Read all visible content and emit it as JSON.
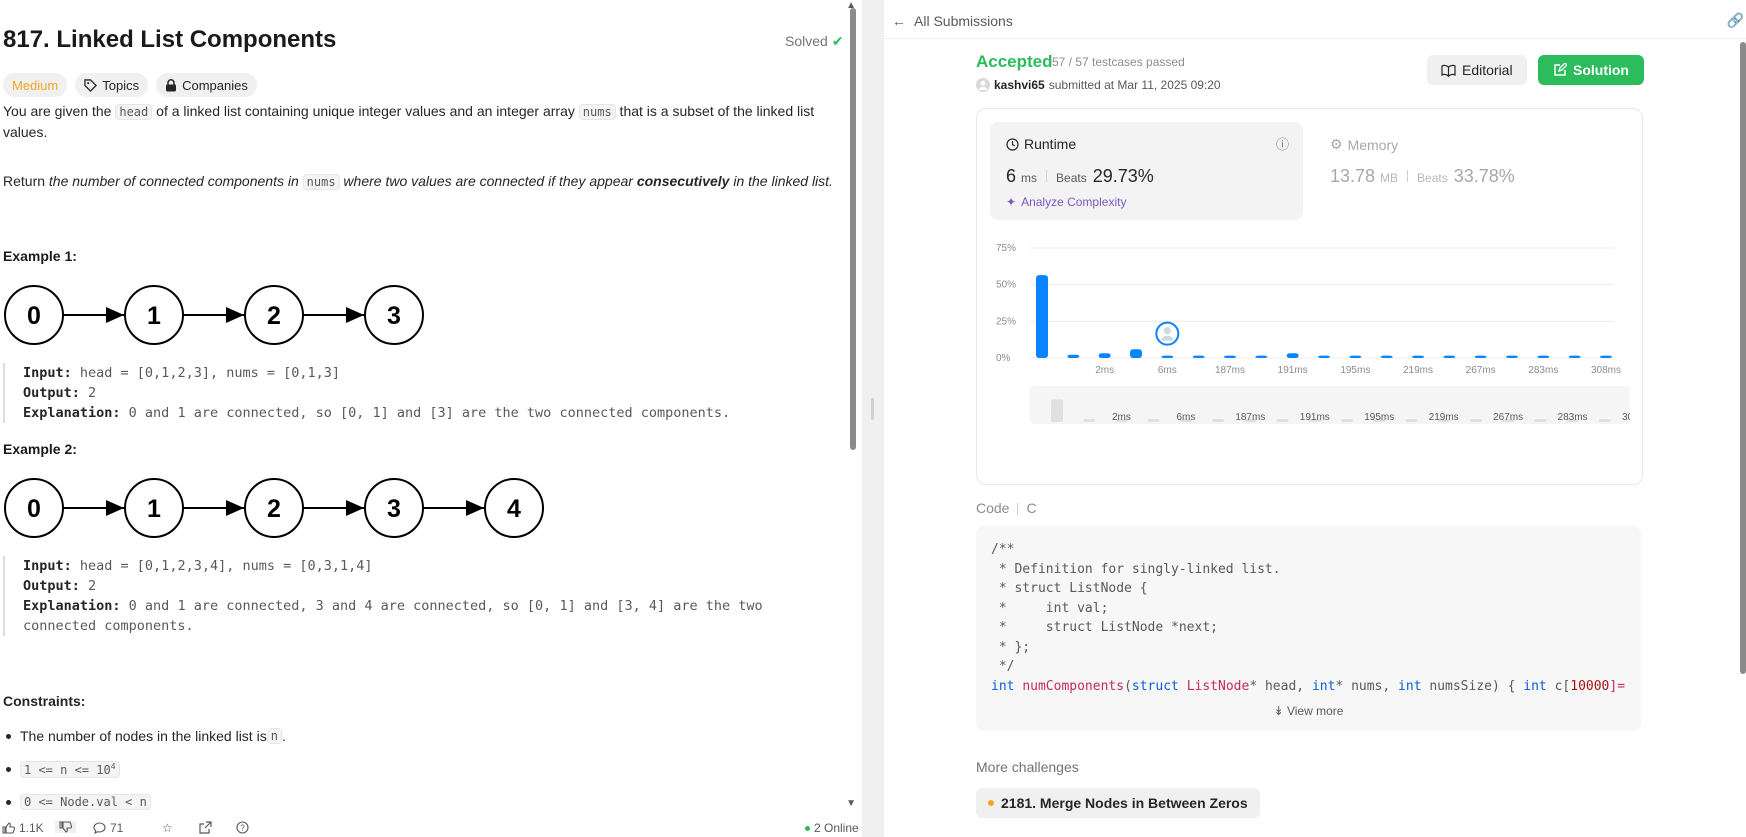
{
  "problem": {
    "title": "817. Linked List Components",
    "solved_label": "Solved",
    "difficulty": "Medium",
    "topics_label": "Topics",
    "companies_label": "Companies",
    "desc1": {
      "a": "You are given the ",
      "code1": "head",
      "b": " of a linked list containing unique integer values and an integer array ",
      "code2": "nums",
      "c": " that is a subset of the linked list values."
    },
    "desc2": {
      "a": "Return ",
      "b": "the number of connected components in ",
      "code": "nums",
      "c": " where two values are connected if they appear ",
      "d": "consecutively",
      "e": " in the linked list."
    },
    "examples": [
      {
        "heading": "Example 1:",
        "nodes": [
          "0",
          "1",
          "2",
          "3"
        ],
        "input_label": "Input:",
        "input": " head = [0,1,2,3], nums = [0,1,3]",
        "output_label": "Output:",
        "output": " 2",
        "expl_label": "Explanation:",
        "expl": " 0 and 1 are connected, so [0, 1] and [3] are the two connected components."
      },
      {
        "heading": "Example 2:",
        "nodes": [
          "0",
          "1",
          "2",
          "3",
          "4"
        ],
        "input_label": "Input:",
        "input": " head = [0,1,2,3,4], nums = [0,3,1,4]",
        "output_label": "Output:",
        "output": " 2",
        "expl_label": "Explanation:",
        "expl": " 0 and 1 are connected, 3 and 4 are connected, so [0, 1] and [3, 4] are the two",
        "expl2": "connected components."
      }
    ],
    "constraints_heading": "Constraints:",
    "constraints": {
      "c1_text": "The number of nodes in the linked list is ",
      "c1_code": "n",
      "c1_end": ".",
      "c2_code": "1 <= n <= 10",
      "c2_sup": "4",
      "c3_code": "0 <= Node.val < n"
    },
    "bottom": {
      "likes": "1.1K",
      "comments": "71",
      "online": "2 Online"
    }
  },
  "submission": {
    "back_label": "All Submissions",
    "status": "Accepted",
    "testcases": "57 / 57 testcases passed",
    "user": "kashvi65",
    "submitted": "submitted at Mar 11, 2025 09:20",
    "editorial_label": "Editorial",
    "solution_label": "Solution",
    "runtime": {
      "label": "Runtime",
      "value": "6",
      "unit": "ms",
      "beats_label": "Beats",
      "beats": "29.73%",
      "analyze": "Analyze Complexity"
    },
    "memory": {
      "label": "Memory",
      "value": "13.78",
      "unit": "MB",
      "beats_label": "Beats",
      "beats": "33.78%"
    },
    "code_label": "Code",
    "language": "C",
    "code_lines": [
      "/**",
      " * Definition for singly-linked list.",
      " * struct ListNode {",
      " *     int val;",
      " *     struct ListNode *next;",
      " * };",
      " */"
    ],
    "code_last": {
      "kw1": "int",
      "fn": "numComponents",
      "p1": "(",
      "kw2": "struct",
      "ty": "ListNode",
      "p2": "* head, ",
      "kw3": "int",
      "p3": "* nums, ",
      "kw4": "int",
      "p4": " numsSize) { ",
      "kw5": "int",
      "p5": " c[",
      "num": "10000",
      "p6": "]="
    },
    "view_more": "View more",
    "more_challenges": "More challenges",
    "challenge": "2181. Merge Nodes in Between Zeros"
  },
  "chart_data": {
    "type": "bar",
    "ylabel": "",
    "yticks": [
      "0%",
      "25%",
      "50%",
      "75%"
    ],
    "ylim": [
      0,
      75
    ],
    "categories": [
      "",
      "",
      "2ms",
      "",
      "6ms",
      "",
      "187ms",
      "",
      "191ms",
      "",
      "195ms",
      "",
      "219ms",
      "",
      "267ms",
      "",
      "283ms",
      "",
      "308ms"
    ],
    "xtick_labels": [
      "2ms",
      "6ms",
      "187ms",
      "191ms",
      "195ms",
      "219ms",
      "267ms",
      "283ms",
      "308ms"
    ],
    "values": [
      56.5,
      2.2,
      3.2,
      6.0,
      1.6,
      1.6,
      1.6,
      1.6,
      3.2,
      1.6,
      1.6,
      1.6,
      1.6,
      1.6,
      1.6,
      1.6,
      1.6,
      1.6,
      1.6
    ],
    "user_bar_index": 4,
    "grid": true,
    "color": "#0a84ff"
  }
}
